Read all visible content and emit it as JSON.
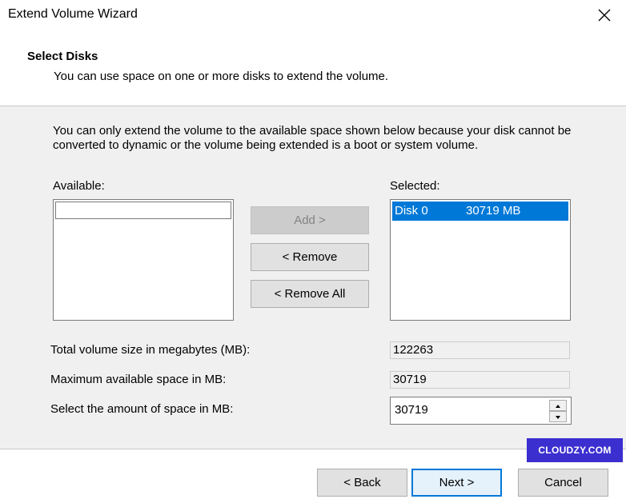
{
  "window": {
    "title": "Extend Volume Wizard",
    "close_icon": "close-icon"
  },
  "header": {
    "title": "Select Disks",
    "subtitle": "You can use space on one or more disks to extend the volume."
  },
  "main": {
    "info": "You can only extend the volume to the available space shown below because your disk cannot be converted to dynamic or the volume being extended is a boot or system volume.",
    "available_label": "Available:",
    "selected_label": "Selected:",
    "available_items": [],
    "selected_items": [
      {
        "disk": "Disk 0",
        "size": "30719 MB"
      }
    ],
    "add_label": "Add >",
    "remove_label": "< Remove",
    "remove_all_label": "< Remove All",
    "total_size_label": "Total volume size in megabytes (MB):",
    "total_size_value": "122263",
    "max_space_label": "Maximum available space in MB:",
    "max_space_value": "30719",
    "select_amount_label": "Select the amount of space in MB:",
    "select_amount_value": "30719"
  },
  "watermark": "CLOUDZY.COM",
  "footer": {
    "back_label": "< Back",
    "next_label": "Next >",
    "cancel_label": "Cancel"
  },
  "colors": {
    "selection": "#0078d7",
    "badge": "#3b2fcf",
    "content_bg": "#f0f0f0"
  }
}
